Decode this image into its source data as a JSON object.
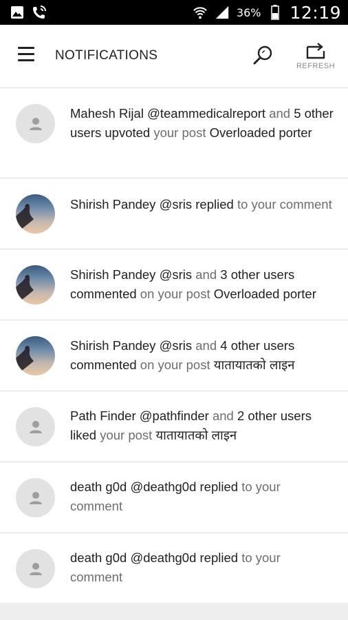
{
  "status_bar": {
    "battery_percent": "36%",
    "time": "12:19"
  },
  "app_bar": {
    "title": "NOTIFICATIONS",
    "refresh_label": "REFRESH"
  },
  "notifications": [
    {
      "avatar": "placeholder",
      "parts": [
        {
          "t": "Mahesh Rijal @teammedicalreport",
          "s": "b"
        },
        {
          "t": " and ",
          "s": "m"
        },
        {
          "t": "5 other users upvoted",
          "s": "b"
        },
        {
          "t": " your post ",
          "s": "m"
        },
        {
          "t": "Overloaded porter",
          "s": "b"
        }
      ]
    },
    {
      "avatar": "photo",
      "parts": [
        {
          "t": "Shirish Pandey @sris replied",
          "s": "b"
        },
        {
          "t": " to your comment",
          "s": "m"
        }
      ]
    },
    {
      "avatar": "photo",
      "parts": [
        {
          "t": "Shirish Pandey @sris",
          "s": "b"
        },
        {
          "t": " and ",
          "s": "m"
        },
        {
          "t": "3 other users commented",
          "s": "b"
        },
        {
          "t": " on your post ",
          "s": "m"
        },
        {
          "t": "Overloaded porter",
          "s": "b"
        }
      ]
    },
    {
      "avatar": "photo",
      "parts": [
        {
          "t": "Shirish Pandey @sris",
          "s": "b"
        },
        {
          "t": " and ",
          "s": "m"
        },
        {
          "t": "4 other users commented",
          "s": "b"
        },
        {
          "t": " on your post ",
          "s": "m"
        },
        {
          "t": "यातायातको लाइन",
          "s": "b"
        }
      ]
    },
    {
      "avatar": "placeholder",
      "parts": [
        {
          "t": "Path Finder @pathfinder",
          "s": "b"
        },
        {
          "t": " and ",
          "s": "m"
        },
        {
          "t": "2 other users liked",
          "s": "b"
        },
        {
          "t": " your post ",
          "s": "m"
        },
        {
          "t": "यातायातको लाइन",
          "s": "b"
        }
      ]
    },
    {
      "avatar": "placeholder",
      "parts": [
        {
          "t": "death g0d @deathg0d replied",
          "s": "b"
        },
        {
          "t": " to your comment",
          "s": "m"
        }
      ]
    },
    {
      "avatar": "placeholder",
      "parts": [
        {
          "t": "death g0d @deathg0d replied",
          "s": "b"
        },
        {
          "t": " to your comment",
          "s": "m"
        }
      ]
    }
  ]
}
